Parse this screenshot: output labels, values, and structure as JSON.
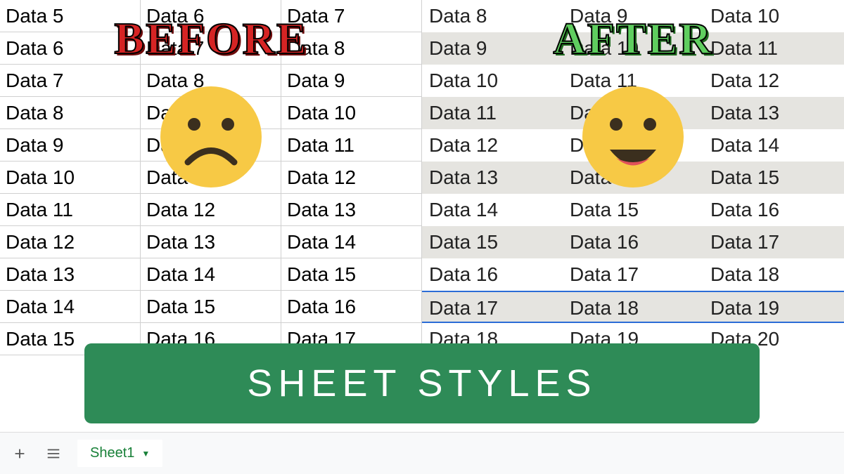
{
  "labels": {
    "before": "BEFORE",
    "after": "AFTER",
    "banner": "SHEET STYLES"
  },
  "sheet_tab": {
    "name": "Sheet1"
  },
  "before_grid": {
    "rows": [
      [
        "Data 5",
        "Data 6",
        "Data 7"
      ],
      [
        "Data 6",
        "Data 7",
        "Data 8"
      ],
      [
        "Data 7",
        "Data 8",
        "Data 9"
      ],
      [
        "Data 8",
        "Data 9",
        "Data 10"
      ],
      [
        "Data 9",
        "Data 10",
        "Data 11"
      ],
      [
        "Data 10",
        "Data 11",
        "Data 12"
      ],
      [
        "Data 11",
        "Data 12",
        "Data 13"
      ],
      [
        "Data 12",
        "Data 13",
        "Data 14"
      ],
      [
        "Data 13",
        "Data 14",
        "Data 15"
      ],
      [
        "Data 14",
        "Data 15",
        "Data 16"
      ],
      [
        "Data 15",
        "Data 16",
        "Data 17"
      ]
    ]
  },
  "after_grid": {
    "rows": [
      [
        "Data 8",
        "Data 9",
        "Data 10"
      ],
      [
        "Data 9",
        "Data 10",
        "Data 11"
      ],
      [
        "Data 10",
        "Data 11",
        "Data 12"
      ],
      [
        "Data 11",
        "Data 12",
        "Data 13"
      ],
      [
        "Data 12",
        "Data 13",
        "Data 14"
      ],
      [
        "Data 13",
        "Data 14",
        "Data 15"
      ],
      [
        "Data 14",
        "Data 15",
        "Data 16"
      ],
      [
        "Data 15",
        "Data 16",
        "Data 17"
      ],
      [
        "Data 16",
        "Data 17",
        "Data 18"
      ],
      [
        "Data 17",
        "Data 18",
        "Data 19"
      ],
      [
        "Data 18",
        "Data 19",
        "Data 20"
      ]
    ]
  },
  "emojis": {
    "sad": "sad-face-icon",
    "happy": "happy-face-icon"
  },
  "colors": {
    "banner_bg": "#2e8b57",
    "before_text": "#d62424",
    "after_text": "#5fce5f",
    "sheet_accent": "#188038",
    "stripe_odd": "#e5e4e0",
    "selection_blue": "#2b6cd6"
  }
}
